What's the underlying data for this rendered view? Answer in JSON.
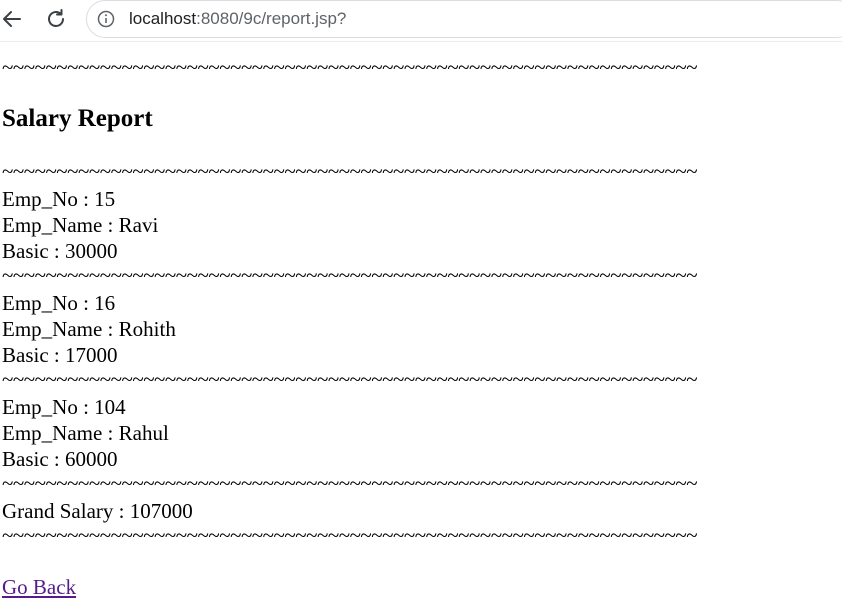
{
  "browser": {
    "url_host": "localhost",
    "url_rest": ":8080/9c/report.jsp?"
  },
  "report": {
    "separator": "~~~~~~~~~~~~~~~~~~~~~~~~~~~~~~~~~~~~~~~~~~~~~~~~~~~~~~~~~~~~~~~~",
    "title": "Salary Report",
    "employees": [
      {
        "emp_no": "Emp_No : 15",
        "emp_name": "Emp_Name : Ravi",
        "basic": "Basic : 30000"
      },
      {
        "emp_no": "Emp_No : 16",
        "emp_name": "Emp_Name : Rohith",
        "basic": "Basic : 17000"
      },
      {
        "emp_no": "Emp_No : 104",
        "emp_name": "Emp_Name : Rahul",
        "basic": "Basic : 60000"
      }
    ],
    "grand_salary": "Grand Salary : 107000",
    "go_back_label": "Go Back"
  }
}
